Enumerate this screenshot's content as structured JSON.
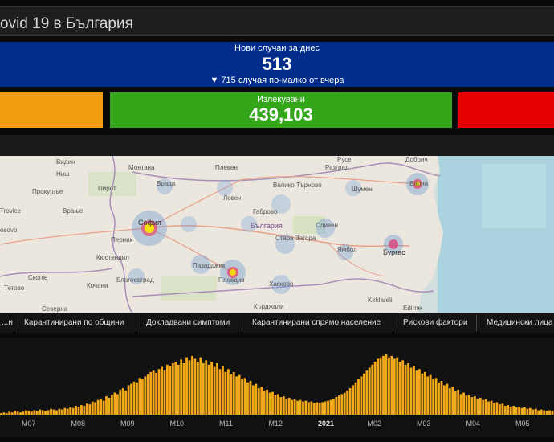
{
  "header": {
    "title": "ovid 19 в България"
  },
  "kpi": {
    "new_cases_label": "Нови случаи за днес",
    "new_cases_value": "513",
    "new_cases_delta": "▼ 715 случая по-малко от вчера",
    "recovered_label": "Излекувани",
    "recovered_value": "439,103",
    "colors": {
      "blue": "#002d8c",
      "orange": "#f29c0f",
      "green": "#33a61a",
      "red": "#e60000"
    }
  },
  "map": {
    "country_label": "България",
    "cities": [
      "Монтана",
      "Плевен",
      "Видин",
      "Враца",
      "Ловеч",
      "Велико Търново",
      "Разград",
      "Шумен",
      "Варна",
      "Ниш",
      "Прокупље",
      "Пирот",
      "Габрово",
      "София",
      "Перник",
      "Кюстендил",
      "Сливен",
      "Стара Загора",
      "Ямбол",
      "Бургас",
      "Пазарджик",
      "Пловдив",
      "Благоевград",
      "Хасково",
      "Кърджали",
      "Скопје",
      "Кочани",
      "Тетово",
      "Северна",
      "Kirklareli",
      "Edirne",
      "Врање",
      "Trovice",
      "osovo",
      "Русе",
      "Добрич"
    ]
  },
  "tabs": [
    "...и",
    "Карантинирани по общини",
    "Докладвани симптоми",
    "Карантинирани спрямо население",
    "Рискови фактори",
    "Медицински лица"
  ],
  "chart_data": {
    "type": "bar",
    "title": "",
    "x_ticks": [
      "M07",
      "M08",
      "M09",
      "M10",
      "M11",
      "M12",
      "2021",
      "M02",
      "M03",
      "M04",
      "M05"
    ],
    "bar_color": "#f2a91a",
    "values_note": "daily new cases, unlabeled y-axis",
    "series": [
      {
        "values": [
          2,
          3,
          2,
          4,
          3,
          5,
          4,
          3,
          4,
          6,
          5,
          4,
          6,
          5,
          7,
          6,
          5,
          6,
          8,
          7,
          6,
          8,
          7,
          9,
          8,
          10,
          9,
          12,
          11,
          13,
          12,
          15,
          14,
          18,
          17,
          20,
          22,
          19,
          25,
          23,
          27,
          30,
          28,
          34,
          36,
          33,
          40,
          42,
          45,
          44,
          50,
          48,
          52,
          55,
          58,
          60,
          57,
          62,
          65,
          60,
          68,
          66,
          70,
          72,
          68,
          75,
          70,
          78,
          74,
          80,
          76,
          72,
          78,
          70,
          74,
          68,
          72,
          65,
          70,
          62,
          66,
          58,
          62,
          55,
          58,
          52,
          54,
          48,
          50,
          44,
          46,
          40,
          42,
          36,
          38,
          33,
          34,
          30,
          31,
          27,
          28,
          24,
          25,
          22,
          23,
          20,
          21,
          19,
          20,
          18,
          19,
          17,
          18,
          16,
          17,
          16,
          17,
          18,
          19,
          20,
          22,
          24,
          26,
          28,
          30,
          33,
          36,
          40,
          44,
          48,
          52,
          56,
          60,
          64,
          68,
          72,
          76,
          78,
          80,
          82,
          78,
          80,
          76,
          78,
          72,
          74,
          68,
          70,
          64,
          66,
          60,
          62,
          56,
          58,
          52,
          54,
          48,
          50,
          44,
          46,
          40,
          42,
          36,
          38,
          32,
          34,
          28,
          30,
          26,
          27,
          24,
          25,
          22,
          23,
          20,
          21,
          18,
          19,
          16,
          17,
          14,
          15,
          12,
          13,
          11,
          12,
          10,
          11,
          9,
          10,
          8,
          9,
          7,
          8,
          6,
          7,
          6,
          5,
          6,
          5
        ]
      }
    ]
  }
}
